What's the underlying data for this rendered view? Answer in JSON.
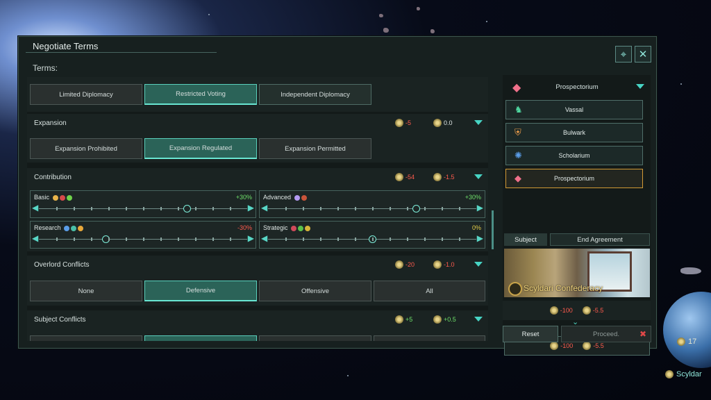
{
  "window": {
    "title": "Negotiate Terms",
    "terms_label": "Terms:"
  },
  "header_buttons": [
    {
      "icon": "target-icon"
    },
    {
      "icon": "close-icon"
    }
  ],
  "diplomacy": {
    "options": [
      "Limited Diplomacy",
      "Restricted Voting",
      "Independent Diplomacy"
    ],
    "selected": "Restricted Voting"
  },
  "expansion": {
    "title": "Expansion",
    "influence": "-5",
    "energy": "0.0",
    "options": [
      "Expansion Prohibited",
      "Expansion Regulated",
      "Expansion Permitted"
    ],
    "selected": "Expansion Regulated"
  },
  "contribution": {
    "title": "Contribution",
    "influence": "-54",
    "energy": "-1.5",
    "sliders": [
      {
        "name": "Basic",
        "pct": "+30%",
        "level": 0.71
      },
      {
        "name": "Advanced",
        "pct": "+30%",
        "level": 0.71
      },
      {
        "name": "Research",
        "pct": "-30%",
        "level": 0.32
      },
      {
        "name": "Strategic",
        "pct": "0%",
        "level": 0.5
      }
    ]
  },
  "overlord_conflicts": {
    "title": "Overlord Conflicts",
    "influence": "-20",
    "energy": "-1.0",
    "options": [
      "None",
      "Defensive",
      "Offensive",
      "All"
    ],
    "selected": "Defensive"
  },
  "subject_conflicts": {
    "title": "Subject Conflicts",
    "influence": "+5",
    "energy": "+0.5"
  },
  "right_panel": {
    "agreement_type": "Prospectorium",
    "types": [
      "Vassal",
      "Bulwark",
      "Scholarium",
      "Prospectorium"
    ],
    "selected_type": "Prospectorium",
    "tabs": [
      "Subject",
      "End Agreement"
    ],
    "empire_name": "Scyldari Confederacy",
    "summary1": {
      "influence": "-100",
      "energy": "-5.5"
    },
    "summary2": {
      "influence": "-100",
      "energy": "-5.5"
    },
    "reset_label": "Reset",
    "proceed_label": "Proceed."
  },
  "background": {
    "resource_value": "17",
    "planet_label": "Scyldar"
  },
  "colors": {
    "accent": "#5ad0bd",
    "negative": "#ff5b4e",
    "positive": "#6ee06a",
    "selected_type_border": "#d29a35"
  }
}
